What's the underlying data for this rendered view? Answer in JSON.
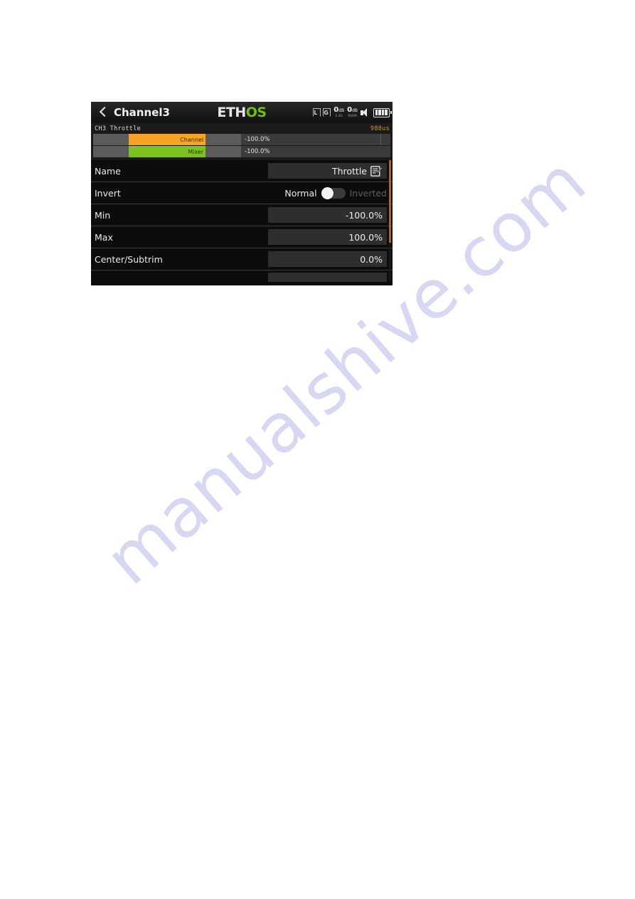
{
  "page": {
    "watermark": "manualshive.com",
    "background_color": "#ffffff"
  },
  "device": {
    "titlebar": {
      "back_icon": "chevron-left-icon",
      "title": "Channel3",
      "logo": {
        "part1": "ETH",
        "part2": "OS",
        "accent_color": "#77c000"
      },
      "status": {
        "rf_icon_label": "L",
        "gps_icon_label": "G",
        "rssi_1": {
          "value": "0",
          "unit": "dB",
          "band": "2.4G"
        },
        "rssi_2": {
          "value": "0",
          "unit": "dB",
          "band": "900M"
        },
        "speaker_icon": "speaker-icon",
        "battery_icon": "battery-icon",
        "battery_bars": 4
      }
    },
    "channel_monitor": {
      "channel_label": "CH3  Throttle",
      "pulse_width": "988us",
      "bars": [
        {
          "name": "Channel",
          "value": "-100.0%",
          "color": "#f5a524",
          "fill_percent": 50,
          "offset_percent": 0
        },
        {
          "name": "Mixer",
          "value": "-100.0%",
          "color": "#7dc21e",
          "fill_percent": 50,
          "offset_percent": 0
        }
      ]
    },
    "settings": {
      "rows": [
        {
          "label": "Name",
          "value": "Throttle",
          "type": "text",
          "icon": "edit-icon"
        },
        {
          "label": "Invert",
          "type": "toggle",
          "option_on": "Normal",
          "option_off": "Inverted",
          "selected": "Normal"
        },
        {
          "label": "Min",
          "value": "-100.0%",
          "type": "number"
        },
        {
          "label": "Max",
          "value": "100.0%",
          "type": "number"
        },
        {
          "label": "Center/Subtrim",
          "value": "0.0%",
          "type": "number"
        },
        {
          "label": "",
          "value": "",
          "type": "partial"
        }
      ],
      "scrollbar_color": "#b5621b"
    }
  }
}
